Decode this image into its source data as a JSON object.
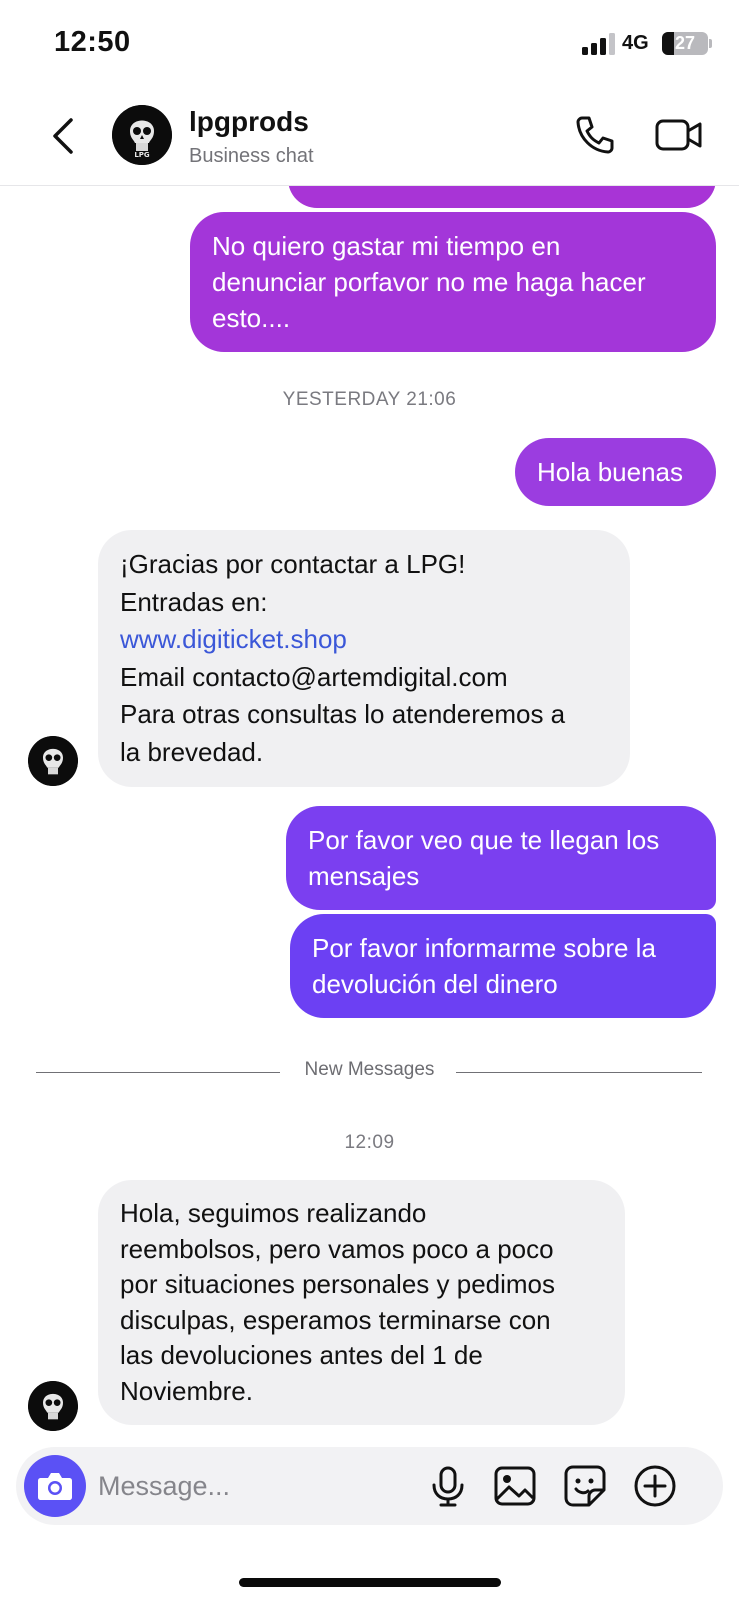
{
  "status_bar": {
    "time": "12:50",
    "network": "4G",
    "battery": "27",
    "battery_level": 0.27
  },
  "header": {
    "name": "lpgprods",
    "subtitle": "Business chat",
    "avatar_text": "LPG",
    "icons": [
      "back-chevron-icon",
      "phone-icon",
      "video-camera-icon"
    ]
  },
  "messages": {
    "m1": {
      "lines": [
        "No quiero gastar mi tiempo en",
        "denunciar porfavor no me haga hacer",
        "esto...."
      ]
    },
    "stamp1": "YESTERDAY 21:06",
    "m2": {
      "lines": [
        "Hola buenas"
      ]
    },
    "m3": {
      "line1": "¡Gracias por contactar a LPG!",
      "line2": "Entradas en:",
      "link": "www.digiticket.shop",
      "line4": "Email contacto@artemdigital.com",
      "line5": "Para otras consultas lo atenderemos a",
      "line6": "la brevedad."
    },
    "m4": {
      "lines": [
        "Por favor veo que te llegan los",
        "mensajes"
      ]
    },
    "m5": {
      "lines": [
        "Por favor informarme sobre la",
        "devolución del dinero"
      ]
    },
    "new_messages_label": "New Messages",
    "stamp2": "12:09",
    "m6": {
      "lines": [
        "Hola, seguimos realizando",
        "reembolsos, pero vamos poco a poco",
        "por situaciones personales y pedimos",
        "disculpas, esperamos terminarse con",
        "las devoluciones antes del 1 de",
        "Noviembre."
      ]
    }
  },
  "composer": {
    "placeholder": "Message...",
    "icons": [
      "camera-icon",
      "microphone-icon",
      "gallery-icon",
      "sticker-icon",
      "add-icon"
    ]
  },
  "colors": {
    "outgoing_magenta": "#a033d8",
    "outgoing_violet": "#6e3ff2",
    "incoming_bg": "#f0f0f2",
    "link": "#3b57d8",
    "camera_button": "#5b51f5"
  }
}
